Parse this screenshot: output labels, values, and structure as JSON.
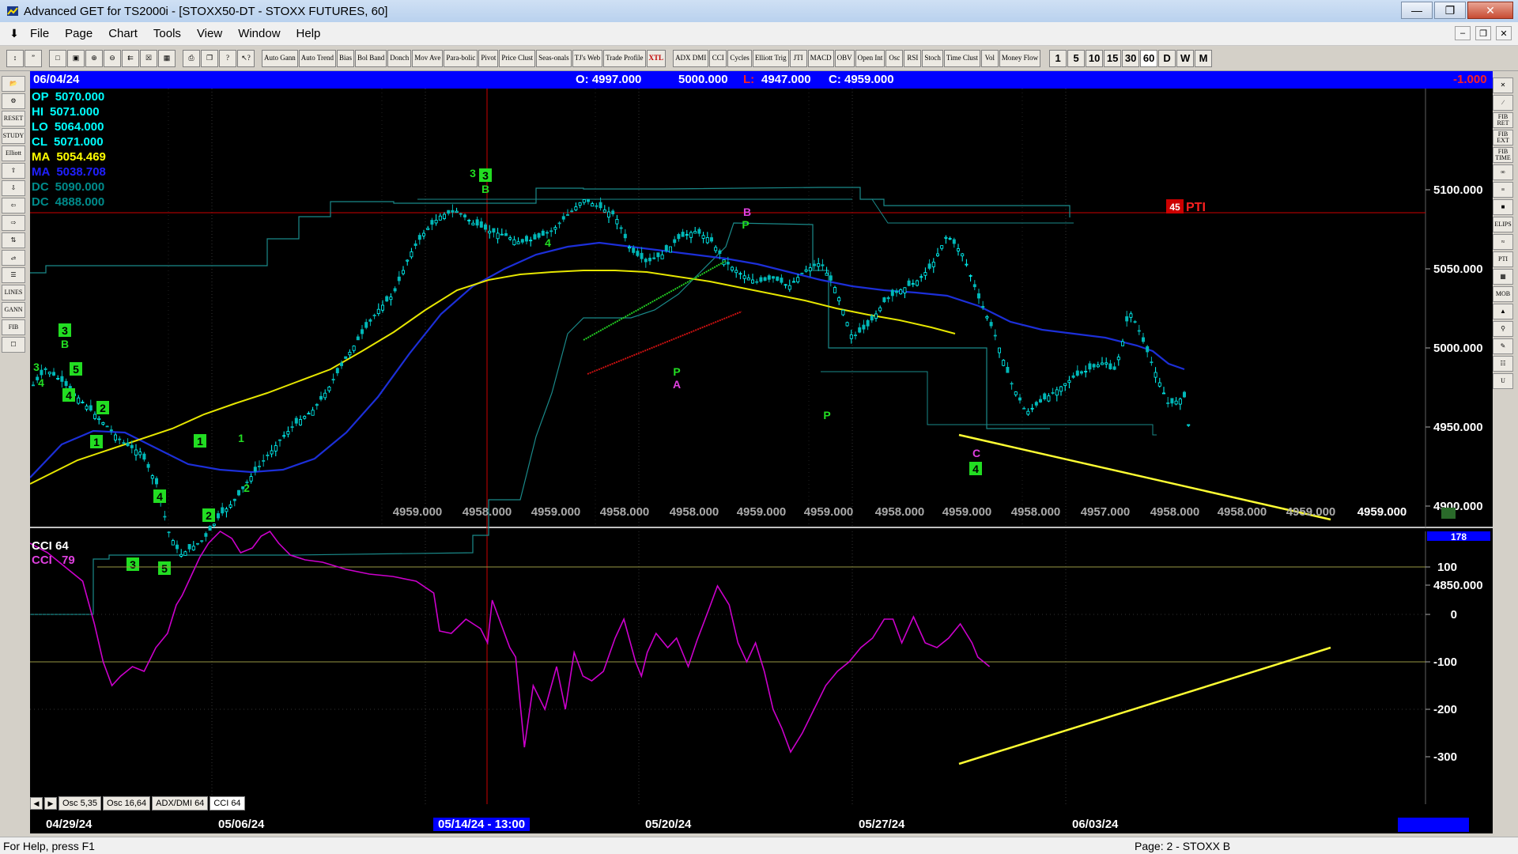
{
  "window": {
    "title": "Advanced GET for TS2000i - [STOXX50-DT - STOXX FUTURES, 60]"
  },
  "menu": [
    "File",
    "Page",
    "Chart",
    "Tools",
    "View",
    "Window",
    "Help"
  ],
  "toolbar": {
    "study_buttons": [
      "Auto Gann",
      "Auto Trend",
      "Bias",
      "Bol Band",
      "Donch",
      "Mov Ave",
      "Para-bolic",
      "Pivot",
      "Price Clust",
      "Seas-onals",
      "TJ's Web",
      "Trade Profile",
      "XTL"
    ],
    "osc_buttons": [
      "ADX DMI",
      "CCI",
      "Cycles",
      "Elliott Trig",
      "JTI",
      "MACD",
      "OBV",
      "Open Int",
      "Osc",
      "RSI",
      "Stoch",
      "Time Clust",
      "Vol",
      "Money Flow"
    ],
    "intervals": [
      "1",
      "5",
      "10",
      "15",
      "30",
      "60",
      "D",
      "W",
      "M"
    ]
  },
  "left_tools": [
    "",
    "",
    "RESET",
    "STUDY",
    "Elliott",
    "",
    "",
    "",
    "",
    "",
    "",
    "",
    "LINES",
    "GANN",
    "FIB",
    ""
  ],
  "right_tools": [
    "",
    "",
    "FIB RET",
    "FIB EXT",
    "FIB TIME",
    "",
    "",
    "",
    "ELIPS",
    "",
    "PTI",
    "",
    "MOB",
    "",
    "",
    "",
    "",
    ""
  ],
  "info_bar": {
    "date": "06/04/24",
    "open": "O: 4997.000",
    "high": "5000.000",
    "low_label": "L:",
    "low_value": "4947.000",
    "close": "C: 4959.000",
    "change": "-1.000"
  },
  "readouts": [
    {
      "label": "OP",
      "value": "5070.000",
      "color": "#00ffff"
    },
    {
      "label": "HI",
      "value": "5071.000",
      "color": "#00ffff"
    },
    {
      "label": "LO",
      "value": "5064.000",
      "color": "#00ffff"
    },
    {
      "label": "CL",
      "value": "5071.000",
      "color": "#00ffff"
    },
    {
      "label": "MA",
      "value": "5054.469",
      "color": "#ffff00"
    },
    {
      "label": "MA",
      "value": "5038.708",
      "color": "#2020ff"
    },
    {
      "label": "DC",
      "value": "5090.000",
      "color": "#008b8b"
    },
    {
      "label": "DC",
      "value": "4888.000",
      "color": "#008b8b"
    }
  ],
  "pti_label": "PTI",
  "pti_value": "45",
  "price_scale": [
    "5100.000",
    "5050.000",
    "5000.000",
    "4950.000",
    "4900.000",
    "4850.000"
  ],
  "bottom_prices": [
    "4959.000",
    "4958.000",
    "4959.000",
    "4958.000",
    "4958.000",
    "4959.000",
    "4959.000",
    "4958.000",
    "4959.000",
    "4958.000",
    "4957.000",
    "4958.000",
    "4958.000",
    "4959.000",
    "4959.000"
  ],
  "wave_labels": [
    {
      "text": "3",
      "style": "plain"
    },
    {
      "text": "3",
      "style": "box"
    },
    {
      "text": "B",
      "style": "plain"
    },
    {
      "text": "4",
      "style": "plain"
    },
    {
      "text": "3",
      "style": "box"
    },
    {
      "text": "B",
      "style": "plain"
    },
    {
      "text": "3",
      "style": "plain"
    },
    {
      "text": "4",
      "style": "plain"
    },
    {
      "text": "5",
      "style": "box"
    },
    {
      "text": "4",
      "style": "box"
    },
    {
      "text": "2",
      "style": "box"
    },
    {
      "text": "1",
      "style": "box"
    },
    {
      "text": "1",
      "style": "box"
    },
    {
      "text": "2",
      "style": "plain"
    },
    {
      "text": "1",
      "style": "plain"
    },
    {
      "text": "4",
      "style": "box"
    },
    {
      "text": "2",
      "style": "box"
    },
    {
      "text": "3",
      "style": "box"
    },
    {
      "text": "5",
      "style": "box"
    },
    {
      "text": "P",
      "style": "plain"
    },
    {
      "text": "A",
      "style": "magenta"
    },
    {
      "text": "B",
      "style": "magenta"
    },
    {
      "text": "P",
      "style": "plain"
    },
    {
      "text": "P",
      "style": "plain"
    },
    {
      "text": "C",
      "style": "magenta"
    },
    {
      "text": "4",
      "style": "box"
    }
  ],
  "cci": {
    "label1": "CCI 64",
    "label2": "CCI",
    "value2": "79",
    "scale": [
      "100",
      "0",
      "-100",
      "-200",
      "-300"
    ],
    "top_value": "178"
  },
  "tabs": [
    "Osc 5,35",
    "Osc 16,64",
    "ADX/DMI 64",
    "CCI 64"
  ],
  "dates": [
    "04/29/24",
    "05/06/24",
    "05/14/24 - 13:00",
    "05/20/24",
    "05/27/24",
    "06/03/24"
  ],
  "status": {
    "left": "For Help, press F1",
    "right": "Page: 2 - STOXX B"
  },
  "colors": {
    "ma_fast": "#ffff00",
    "ma_slow": "#2020ff",
    "donchian": "#008b8b",
    "cci": "#cc00cc",
    "trendline": "#ffff33"
  }
}
